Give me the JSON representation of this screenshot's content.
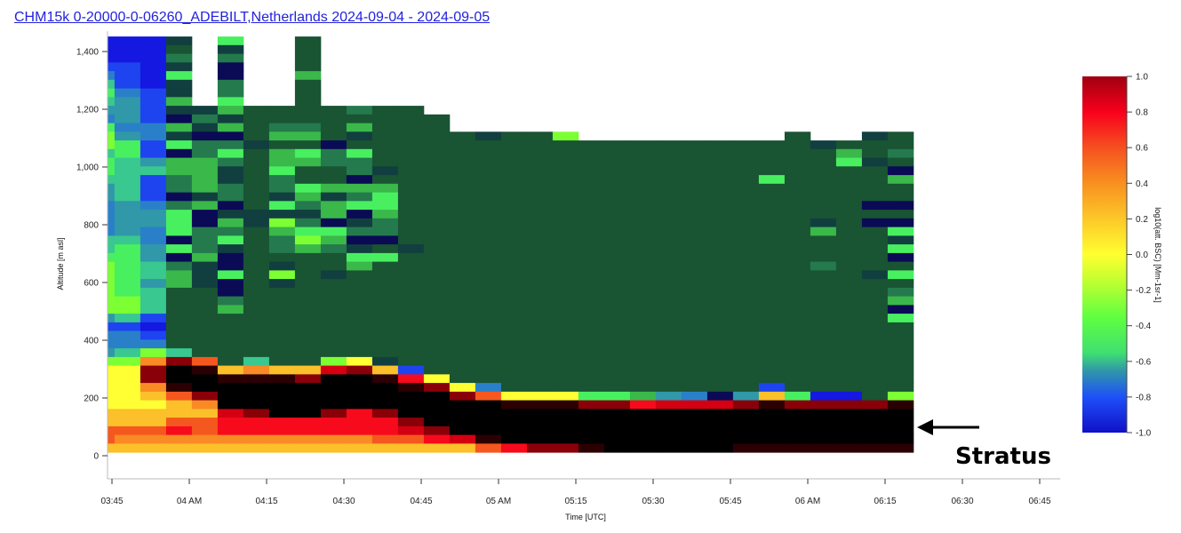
{
  "title": "CHM15k 0-20000-0-06260_ADEBILT,Netherlands 2024-09-04 - 2024-09-05",
  "chart_data": {
    "type": "heatmap",
    "title": "CHM15k 0-20000-0-06260_ADEBILT,Netherlands 2024-09-04 - 2024-09-05",
    "xlabel": "Time [UTC]",
    "ylabel": "Altitude [m asl]",
    "x_ticks": [
      "03:45",
      "04 AM",
      "04:15",
      "04:30",
      "04:45",
      "05 AM",
      "05:15",
      "05:30",
      "05:45",
      "06 AM",
      "06:15",
      "06:30",
      "06:45"
    ],
    "x_tick_minutes": [
      0,
      15,
      30,
      45,
      60,
      75,
      90,
      105,
      120,
      135,
      150,
      165,
      180
    ],
    "x_range_min": [
      -0.9,
      184
    ],
    "y_ticks": [
      "0",
      "200",
      "400",
      "600",
      "800",
      "1,000",
      "1,200",
      "1,400"
    ],
    "y_tick_values": [
      0,
      200,
      400,
      600,
      800,
      1000,
      1200,
      1400
    ],
    "y_range": [
      -80,
      1470
    ],
    "grid": false,
    "cells": {
      "first_col_start_min": -0.9,
      "second_col_start_min": 0.5,
      "col_width_min": 5,
      "row_base_m": 12,
      "row_height_m": 30,
      "rows_top_to_bottom_rle": [
        "D3n.g.2G.23",
        "D3G.n.2G.23",
        "D3e.e.2G.23",
        "B2Dn.N.2G.23",
        "bBDg.N.2h.23",
        "tBDn.e.2G.23",
        "gbBn.e.2G.23",
        "tcBh.g.2G.23",
        "c2BnnhG4eG2.19",
        "bcBNenG8.18",
        "gbbhnhGeeGhG3.18",
        "LcbnNNGhhGnG4nG2L.8G.2nG",
        "LgBgeenG2NG18nG3",
        "tgBNegGhgegG18hGe",
        "gtchheGhheeG18gnG",
        "gtthhnGgG2enG19N",
        "ttBehnGeG2NG15gG4h",
        "ctBeheGeghhhG20",
        "ctBNneGnhnegG20",
        "bcbehNGgehggG18N2",
        "bccgNn4hNhG20",
        "bccgNhnLeNneG16nGN2",
        "bcbgeeGhggeeG16hG2g",
        "ttbNegGeLhN2G19n",
        "tgcgenGehenGnG18g",
        "ggcNhNG4g2G19N",
        "LgtenNGnG2hG17eG3",
        "LgthngGLGnG20ng",
        "LgchnNGnG24",
        "LgtG2NG25e",
        "L2tG2eG25h",
        "L2tG2hG25N",
        "ctBG28g",
        "B2DG29",
        "b2BG29",
        "b3G29",
        "ctLtG28",
        "L2omOGtG2LynG20",
        "y2mKkYoY2RmYBG19",
        "y2mK2k3mK2kryG18",
        "y2okK8kmybG10BG5",
        "y2YOmK9mOy3g2hcbNcYgD2GL",
        "y3YoK11k3m2rR3mkm4k",
        "Y5RmK2mrmK20",
        "Y3O2r7mK19",
        "O3rOr7RmK18",
        "Oo10O2rRkK16",
        "Y15OrmmkK5k7"
      ],
      "palette": {
        "G": "#195433",
        "K": "#000000",
        "k": "#2a0002",
        "m": "#8a0008",
        "R": "#d40012",
        "r": "#f70a1c",
        "O": "#f5581e",
        "o": "#f98a25",
        "Y": "#fbc02a",
        "y": "#ffff33",
        "L": "#7cff33",
        "g": "#48f060",
        "h": "#3ab84a",
        "t": "#38c890",
        "c": "#3098a8",
        "b": "#2a80c8",
        "B": "#1e44f0",
        "D": "#1418e0",
        "N": "#0a0a55",
        "n": "#113f40",
        "e": "#247a4c"
      }
    },
    "colorbar": {
      "label": "log10(att. BSC) [Mm-1sr-1]",
      "range": [
        -1.0,
        1.0
      ],
      "ticks": [
        "1.0",
        "0.8",
        "0.6",
        "0.4",
        "0.2",
        "0.0",
        "-0.2",
        "-0.4",
        "-0.6",
        "-0.8",
        "-1.0"
      ],
      "tick_values": [
        1.0,
        0.8,
        0.6,
        0.4,
        0.2,
        0.0,
        -0.2,
        -0.4,
        -0.6,
        -0.8,
        -1.0
      ],
      "stops": [
        {
          "v": -1.0,
          "color": "#1010c8"
        },
        {
          "v": -0.8,
          "color": "#1e50f8"
        },
        {
          "v": -0.65,
          "color": "#3098a8"
        },
        {
          "v": -0.55,
          "color": "#40e070"
        },
        {
          "v": -0.35,
          "color": "#60ff40"
        },
        {
          "v": -0.15,
          "color": "#c0ff30"
        },
        {
          "v": 0.0,
          "color": "#ffff30"
        },
        {
          "v": 0.2,
          "color": "#fcc828"
        },
        {
          "v": 0.4,
          "color": "#f89020"
        },
        {
          "v": 0.6,
          "color": "#f55020"
        },
        {
          "v": 0.8,
          "color": "#f8001c"
        },
        {
          "v": 1.0,
          "color": "#a00010"
        }
      ]
    },
    "annotation": {
      "text": "Stratus",
      "arrow": "left"
    }
  }
}
